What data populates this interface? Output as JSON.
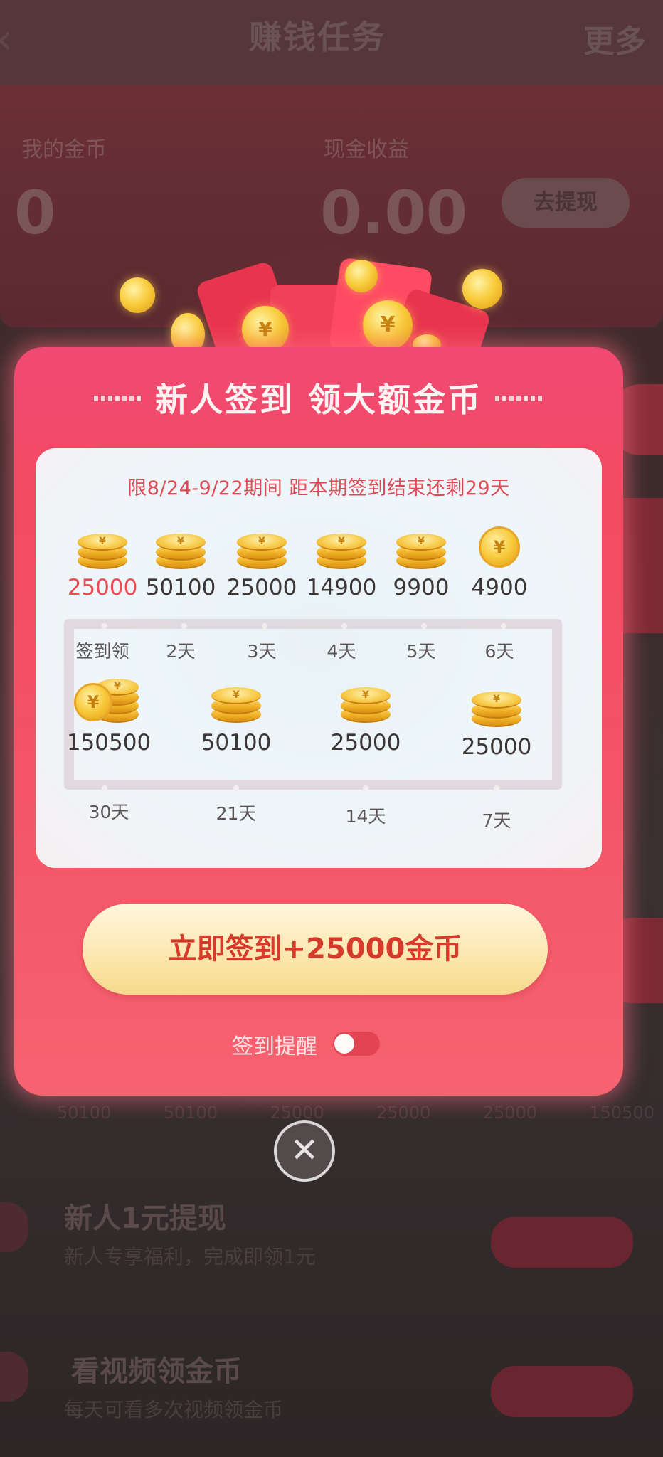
{
  "background": {
    "title": "赚钱任务",
    "more": "更多",
    "back_icon": "chevron-left-icon",
    "coins_label": "我的金币",
    "cash_label": "现金收益",
    "coins_value": "0",
    "cash_value": "0.00",
    "withdraw_label": "去提现",
    "day_amounts": [
      "50100",
      "50100",
      "25000",
      "25000",
      "25000",
      "150500"
    ],
    "task1_title": "新人1元提现",
    "task1_sub": "新人专享福利，完成即领1元",
    "task2_title": "看视频领金币",
    "task2_sub": "每天可看多次视频领金币"
  },
  "modal": {
    "title": "新人签到 领大额金币",
    "period_text": "限8/24-9/22期间 距本期签到结束还剩29天",
    "row1": [
      {
        "amount": "25000",
        "day": "签到领",
        "icon": "coin-stack-icon"
      },
      {
        "amount": "50100",
        "day": "2天",
        "icon": "coin-stack-icon"
      },
      {
        "amount": "25000",
        "day": "3天",
        "icon": "coin-stack-icon"
      },
      {
        "amount": "14900",
        "day": "4天",
        "icon": "coin-stack-icon"
      },
      {
        "amount": "9900",
        "day": "5天",
        "icon": "coin-stack-icon"
      },
      {
        "amount": "4900",
        "day": "6天",
        "icon": "coin-icon"
      }
    ],
    "row2": [
      {
        "amount": "150500",
        "day": "30天",
        "icon": "coin-pile-icon"
      },
      {
        "amount": "50100",
        "day": "21天",
        "icon": "coin-stack-icon"
      },
      {
        "amount": "25000",
        "day": "14天",
        "icon": "coin-stack-icon"
      },
      {
        "amount": "25000",
        "day": "7天",
        "icon": "coin-stack-icon"
      }
    ],
    "cta_label": "立即签到+25000金币",
    "reminder_label": "签到提醒",
    "reminder_on": false,
    "close_icon": "close-icon",
    "colors": {
      "modal_red": "#f24a66",
      "highlight_amount": "#ee4b52",
      "cta_text": "#d53a2a",
      "cta_bg": "#fbe6ad",
      "coin_gold": "#f2b52a"
    }
  }
}
